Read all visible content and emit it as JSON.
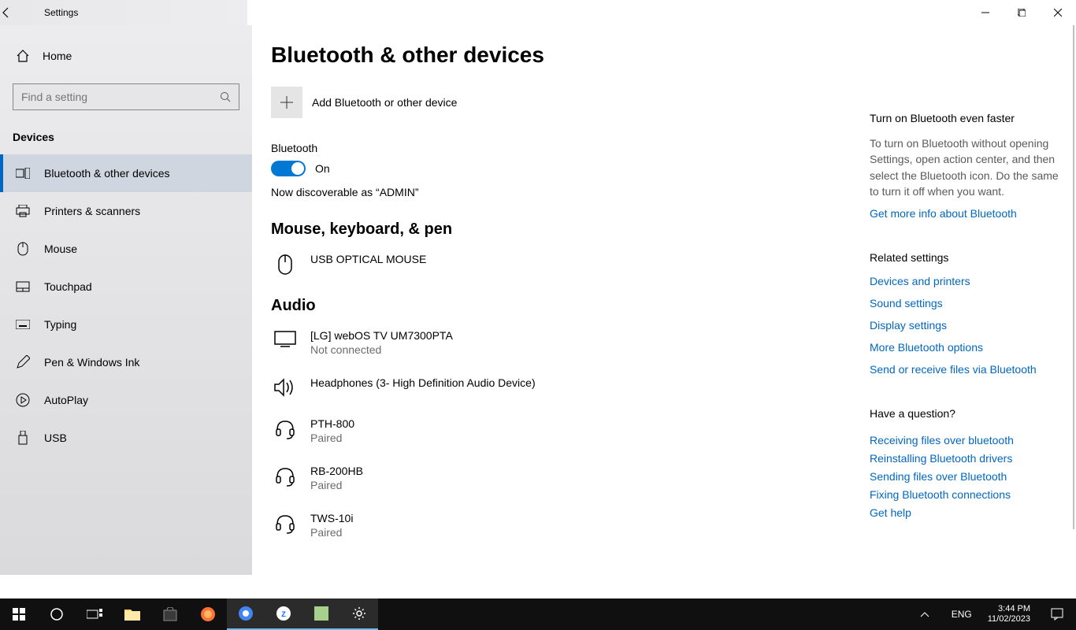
{
  "window": {
    "title": "Settings"
  },
  "sidebar": {
    "home": "Home",
    "search_placeholder": "Find a setting",
    "category": "Devices",
    "items": [
      {
        "label": "Bluetooth & other devices",
        "icon": "bluetooth"
      },
      {
        "label": "Printers & scanners",
        "icon": "printer"
      },
      {
        "label": "Mouse",
        "icon": "mouse"
      },
      {
        "label": "Touchpad",
        "icon": "touchpad"
      },
      {
        "label": "Typing",
        "icon": "keyboard"
      },
      {
        "label": "Pen & Windows Ink",
        "icon": "pen"
      },
      {
        "label": "AutoPlay",
        "icon": "autoplay"
      },
      {
        "label": "USB",
        "icon": "usb"
      }
    ]
  },
  "main": {
    "title": "Bluetooth & other devices",
    "add_label": "Add Bluetooth or other device",
    "bt_label": "Bluetooth",
    "bt_state": "On",
    "discoverable": "Now discoverable as “ADMIN”",
    "section_mouse": "Mouse, keyboard, & pen",
    "section_audio": "Audio",
    "devices_mouse": [
      {
        "name": "USB OPTICAL MOUSE",
        "status": "",
        "icon": "mouse"
      }
    ],
    "devices_audio": [
      {
        "name": "[LG] webOS TV UM7300PTA",
        "status": "Not connected",
        "icon": "tv"
      },
      {
        "name": "Headphones (3- High Definition Audio Device)",
        "status": "",
        "icon": "speaker"
      },
      {
        "name": "PTH-800",
        "status": "Paired",
        "icon": "headset"
      },
      {
        "name": "RB-200HB",
        "status": "Paired",
        "icon": "headset"
      },
      {
        "name": "TWS-10i",
        "status": "Paired",
        "icon": "headset"
      }
    ]
  },
  "right": {
    "tip_title": "Turn on Bluetooth even faster",
    "tip_body": "To turn on Bluetooth without opening Settings, open action center, and then select the Bluetooth icon. Do the same to turn it off when you want.",
    "tip_link": "Get more info about Bluetooth",
    "related_title": "Related settings",
    "related": [
      "Devices and printers",
      "Sound settings",
      "Display settings",
      "More Bluetooth options",
      "Send or receive files via Bluetooth"
    ],
    "question_title": "Have a question?",
    "question": [
      "Receiving files over bluetooth",
      "Reinstalling Bluetooth drivers",
      "Sending files over Bluetooth",
      "Fixing Bluetooth connections",
      "Get help"
    ]
  },
  "taskbar": {
    "lang": "ENG",
    "time": "3:44 PM",
    "date": "11/02/2023"
  }
}
